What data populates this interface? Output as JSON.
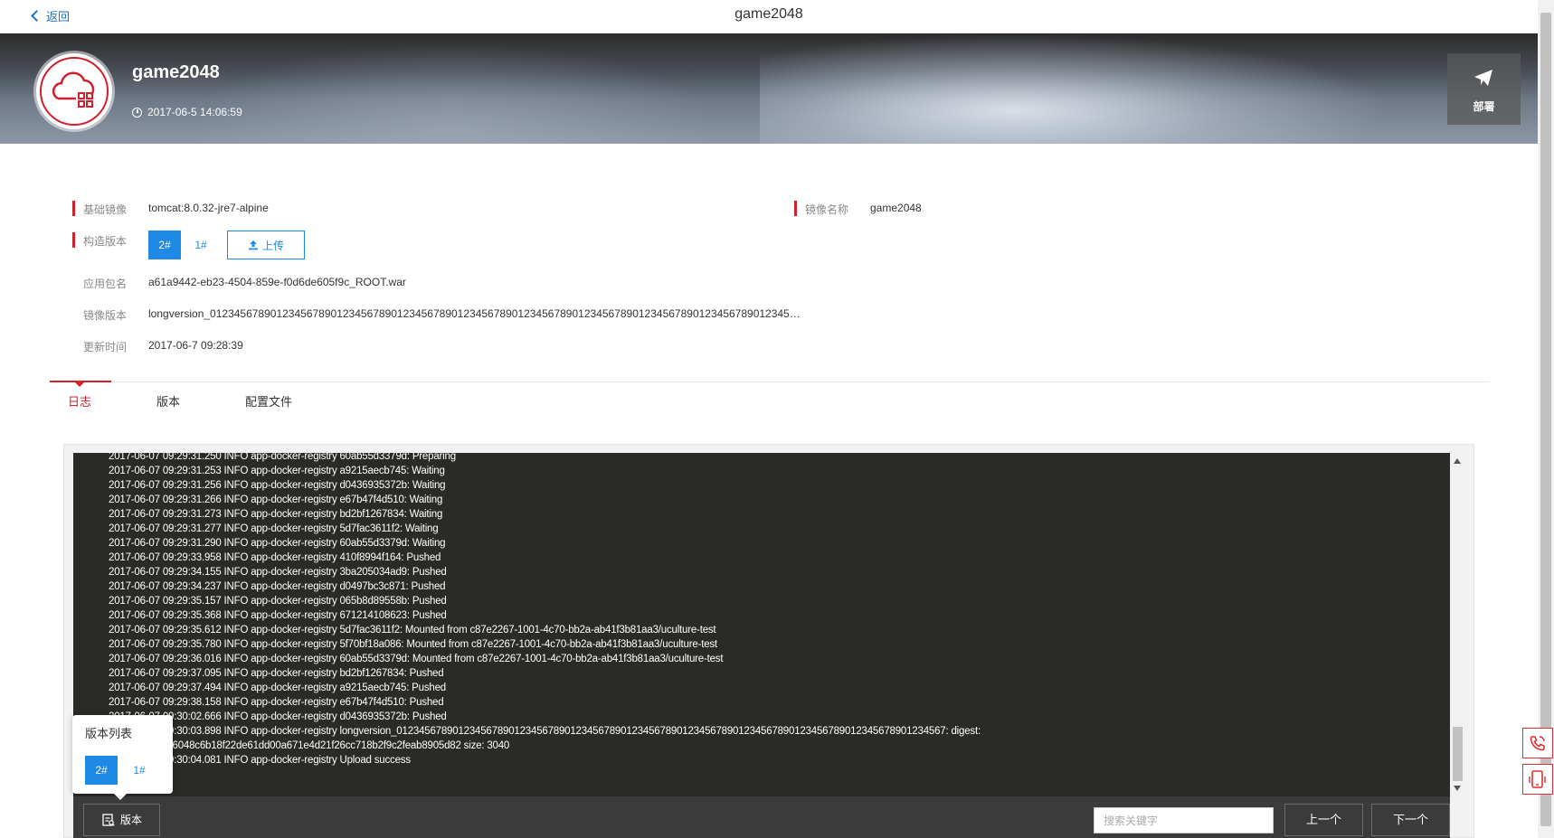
{
  "topbar": {
    "back_label": "返回",
    "title": "game2048"
  },
  "banner": {
    "app_name": "game2048",
    "created_time": "2017-06-5 14:06:59",
    "deploy_label": "部署"
  },
  "info": {
    "base_image_label": "基础镜像",
    "base_image_value": "tomcat:8.0.32-jre7-alpine",
    "image_name_label": "镜像名称",
    "image_name_value": "game2048",
    "build_version_label": "构造版本",
    "build_versions": [
      "2#",
      "1#"
    ],
    "upload_label": "上传",
    "package_label": "应用包名",
    "package_value": "a61a9442-eb23-4504-859e-f0d6de605f9c_ROOT.war",
    "image_version_label": "镜像版本",
    "image_version_value": "longversion_012345678901234567890123456789012345678901234567890123456789012345678901234567890123456789012345…",
    "update_time_label": "更新时间",
    "update_time_value": "2017-06-7 09:28:39"
  },
  "tabs": [
    {
      "label": "日志",
      "active": true
    },
    {
      "label": "版本",
      "active": false
    },
    {
      "label": "配置文件",
      "active": false
    }
  ],
  "log_lines": [
    "2017-06-07 09:29:31.250 INFO app-docker-registry 60ab55d3379d: Preparing",
    "2017-06-07 09:29:31.253 INFO app-docker-registry a9215aecb745: Waiting",
    "2017-06-07 09:29:31.256 INFO app-docker-registry d0436935372b: Waiting",
    "2017-06-07 09:29:31.266 INFO app-docker-registry e67b47f4d510: Waiting",
    "2017-06-07 09:29:31.273 INFO app-docker-registry bd2bf1267834: Waiting",
    "2017-06-07 09:29:31.277 INFO app-docker-registry 5d7fac3611f2: Waiting",
    "2017-06-07 09:29:31.290 INFO app-docker-registry 60ab55d3379d: Waiting",
    "2017-06-07 09:29:33.958 INFO app-docker-registry 410f8994f164: Pushed",
    "2017-06-07 09:29:34.155 INFO app-docker-registry 3ba205034ad9: Pushed",
    "2017-06-07 09:29:34.237 INFO app-docker-registry d0497bc3c871: Pushed",
    "2017-06-07 09:29:35.157 INFO app-docker-registry 065b8d89558b: Pushed",
    "2017-06-07 09:29:35.368 INFO app-docker-registry 671214108623: Pushed",
    "2017-06-07 09:29:35.612 INFO app-docker-registry 5d7fac3611f2: Mounted from c87e2267-1001-4c70-bb2a-ab41f3b81aa3/uculture-test",
    "2017-06-07 09:29:35.780 INFO app-docker-registry 5f70bf18a086: Mounted from c87e2267-1001-4c70-bb2a-ab41f3b81aa3/uculture-test",
    "2017-06-07 09:29:36.016 INFO app-docker-registry 60ab55d3379d: Mounted from c87e2267-1001-4c70-bb2a-ab41f3b81aa3/uculture-test",
    "2017-06-07 09:29:37.095 INFO app-docker-registry bd2bf1267834: Pushed",
    "2017-06-07 09:29:37.494 INFO app-docker-registry a9215aecb745: Pushed",
    "2017-06-07 09:29:38.158 INFO app-docker-registry e67b47f4d510: Pushed",
    "2017-06-07 09:30:02.666 INFO app-docker-registry d0436935372b: Pushed",
    "2017-06-07 09:30:03.898 INFO app-docker-registry longversion_01234567890123456789012345678901234567890123456789012345678901234567890123456789012345678901234567: digest:",
    "sha256:8a37b6048c6b18f22de61dd00a671e4d21f26cc718b2f9c2feab8905d82 size: 3040",
    "2017-06-07 09:30:04.081 INFO app-docker-registry Upload success"
  ],
  "log_bottom": {
    "version_button_label": "版本",
    "search_placeholder": "搜索关键字",
    "prev_label": "上一个",
    "next_label": "下一个"
  },
  "version_popover": {
    "title": "版本列表",
    "versions": [
      "2#",
      "1#"
    ]
  }
}
